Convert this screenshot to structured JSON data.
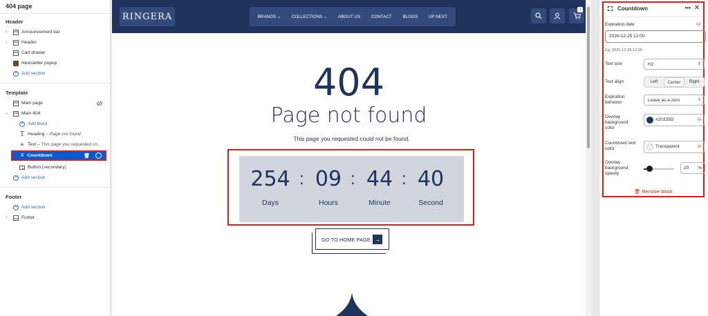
{
  "left": {
    "page_title": "404 page",
    "header": {
      "title": "Header",
      "items": [
        "Announcement bar",
        "Header",
        "Cart drawer",
        "Newsletter popup"
      ],
      "add": "Add section"
    },
    "template": {
      "title": "Template",
      "main_page": "Main page",
      "main_404": "Main 404",
      "add_block": "Add block",
      "heading_label": "Heading",
      "heading_value": "Page not found",
      "text_label": "Text",
      "text_value": "This page you requested co...",
      "selected": "Countdown",
      "button": "Button (secondary)",
      "add": "Add section"
    },
    "footer": {
      "title": "Footer",
      "add": "Add section",
      "item": "Footer"
    }
  },
  "preview": {
    "logo": "RINGERA",
    "menu": [
      "BRANDS",
      "COLLECTIONS",
      "ABOUT US",
      "CONTACT",
      "BLOGS",
      "UP NEXT"
    ],
    "cart_count": "1",
    "code": "404",
    "title": "Page not found",
    "subtitle": "This page you requested could not be found.",
    "countdown": {
      "days": "254",
      "hours": "09",
      "minutes": "44",
      "seconds": "40",
      "days_label": "Days",
      "hours_label": "Hours",
      "minutes_label": "Minute",
      "seconds_label": "Second",
      "sep": ":"
    },
    "home_button": "GO TO HOME PAGE"
  },
  "settings": {
    "title": "Countdown",
    "expiration_label": "Expiration date",
    "expiration_value": "2026-12-25 12:00",
    "expiration_hint": "Eg. 2025-12-25 12:00",
    "text_size_label": "Text size",
    "text_size_value": "H2",
    "text_align_label": "Text align",
    "align_options": [
      "Left",
      "Center",
      "Right"
    ],
    "align_selected": "Center",
    "behavior_label_1": "Expiration",
    "behavior_label_2": "behavior",
    "behavior_value": "Leave as a zero",
    "overlay_bg_label_1": "Overlay",
    "overlay_bg_label_2": "background",
    "overlay_bg_label_3": "color",
    "overlay_bg_value": "#20335D",
    "countdown_color_label_1": "Countdown text",
    "countdown_color_label_2": "color",
    "countdown_color_value": "Transparent",
    "opacity_label_1": "Overlay",
    "opacity_label_2": "background",
    "opacity_label_3": "opacity",
    "opacity_value": "20",
    "opacity_unit": "%",
    "remove": "Remove block"
  },
  "colors": {
    "navy": "#20335d",
    "accent": "#005bd3",
    "highlight": "#e01b1b",
    "countdown_bg": "#d1d5dd"
  }
}
